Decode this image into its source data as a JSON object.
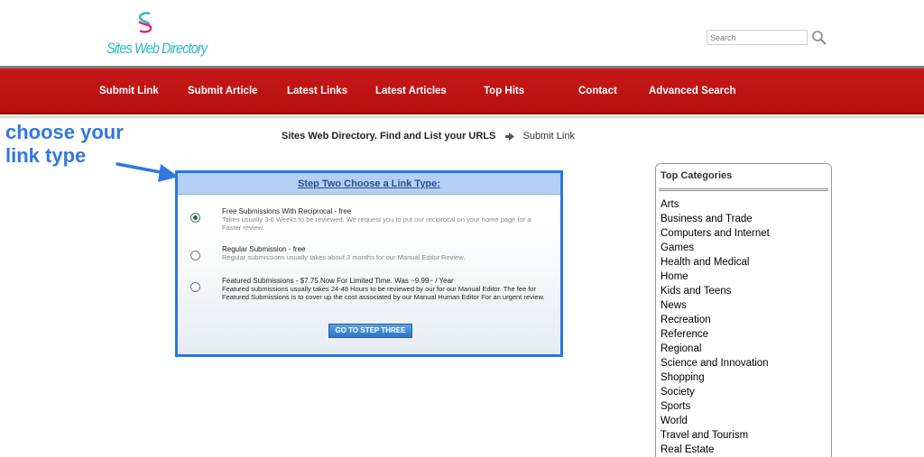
{
  "header": {
    "logo_text": "Sites Web Directory",
    "search_placeholder": "Search",
    "search_icon": "magnifier-icon"
  },
  "nav": {
    "items": [
      "Submit Link",
      "Submit Article",
      "Latest Links",
      "Latest Articles",
      "Top Hits",
      "Contact",
      "Advanced Search"
    ]
  },
  "annotation": {
    "line1": "choose your",
    "line2": "link type",
    "color": "#2f78e0"
  },
  "breadcrumb": {
    "home": "Sites Web Directory. Find and List your URLS",
    "current": "Submit Link"
  },
  "step": {
    "title": "Step Two Choose a Link Type:",
    "options": [
      {
        "title": "Free Submissions With Reciprocal - free",
        "desc": "Takes usually 3-6 Weeks to be reviewed. We request you to put our reciprocal on your home page for a Faster review.",
        "checked": true
      },
      {
        "title": "Regular Submission - free",
        "desc": "Regular submissions usually takes about 3 months for our Manual Editor Review.",
        "checked": false
      },
      {
        "title": "Featured Submissions - $7.75 Now For Limited Time. Was ~9.99~ / Year",
        "desc": "Featured submissions usually takes 24-48 Hours to be reviewed by our for our Manual Editor. The fee for Featured Submissions is to cover up the cost associated by our Manual Human Editor For an urgent review.",
        "checked": false
      }
    ],
    "button_label": "GO TO STEP THREE"
  },
  "categories": {
    "title": "Top Categories",
    "items": [
      "Arts",
      "Business and Trade",
      "Computers and Internet",
      "Games",
      "Health and Medical",
      "Home",
      "Kids and Teens",
      "News",
      "Recreation",
      "Reference",
      "Regional",
      "Science and Innovation",
      "Shopping",
      "Society",
      "Sports",
      "World",
      "Travel and Tourism",
      "Real Estate"
    ]
  },
  "colors": {
    "nav_red": "#c81818",
    "highlight_blue": "#2777e4",
    "logo_teal": "#2bb8c9"
  }
}
